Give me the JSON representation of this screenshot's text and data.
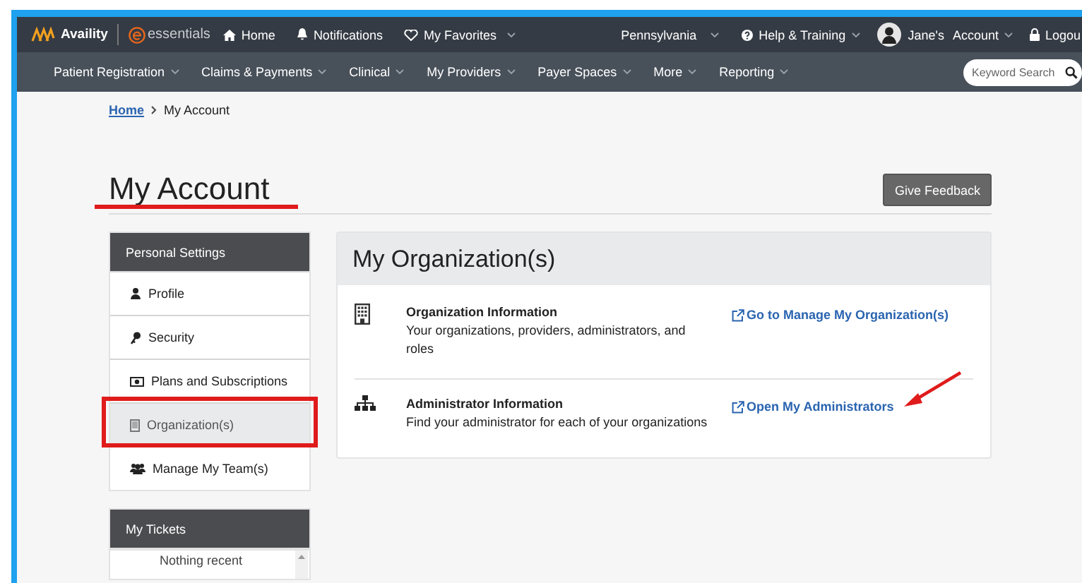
{
  "topbar": {
    "brand": "Availity",
    "product": "essentials",
    "links": [
      {
        "label": "Home",
        "has_menu": false
      },
      {
        "label": "Notifications",
        "has_menu": false
      },
      {
        "label": "My Favorites",
        "has_menu": true
      }
    ],
    "region": "Pennsylvania",
    "help": "Help & Training",
    "user_name": "Jane's",
    "account": "Account",
    "logout": "Logou"
  },
  "nav": {
    "items": [
      {
        "label": "Patient Registration"
      },
      {
        "label": "Claims & Payments"
      },
      {
        "label": "Clinical"
      },
      {
        "label": "My Providers"
      },
      {
        "label": "Payer Spaces"
      },
      {
        "label": "More"
      },
      {
        "label": "Reporting"
      }
    ],
    "search": {
      "placeholder": "Keyword Search"
    }
  },
  "breadcrumb": [
    {
      "label": "Home",
      "link": true
    },
    {
      "label": "My Account",
      "link": false
    }
  ],
  "page_title": "My Account",
  "feedback_button": "Give Feedback",
  "sidebar": {
    "title": "Personal Settings",
    "items": [
      {
        "label": "Profile",
        "selected": false
      },
      {
        "label": "Security",
        "selected": false
      },
      {
        "label": "Plans and Subscriptions",
        "selected": false
      },
      {
        "label": "Organization(s)",
        "selected": true
      },
      {
        "label": "Manage My Team(s)",
        "selected": false
      }
    ]
  },
  "tickets": {
    "title": "My Tickets",
    "empty_text": "Nothing recent"
  },
  "panel": {
    "title": "My Organization(s)",
    "rows": [
      {
        "title": "Organization Information",
        "description": "Your organizations, providers, administrators, and roles",
        "link": "Go to Manage My Organization(s)"
      },
      {
        "title": "Administrator Information",
        "description": "Find your administrator for each of your organizations",
        "link": "Open My Administrators"
      }
    ]
  }
}
